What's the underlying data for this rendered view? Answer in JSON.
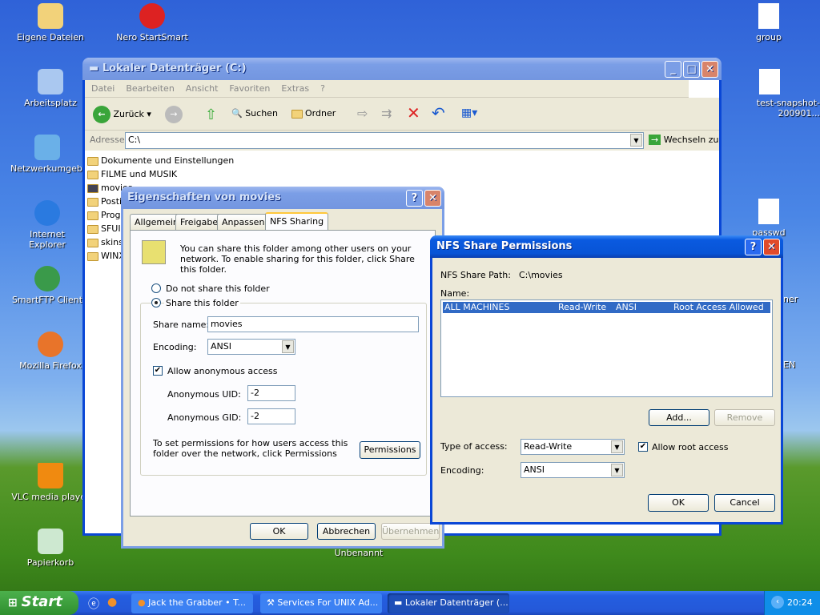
{
  "desktop": {
    "left_icons": [
      "Eigene Dateien",
      "Arbeitsplatz",
      "Netzwerkumgebung",
      "Internet Explorer",
      "SmartFTP Client",
      "Mozilla Firefox",
      "VLC media player",
      "Papierkorb"
    ],
    "nero": "Nero StartSmart",
    "right_icons": [
      "group",
      "test-snapshot-200901...",
      "passwd",
      "ner",
      "EN"
    ],
    "unbenannt": "Unbenannt"
  },
  "explorer": {
    "title": "Lokaler Datenträger (C:)",
    "menu": [
      "Datei",
      "Bearbeiten",
      "Ansicht",
      "Favoriten",
      "Extras",
      "?"
    ],
    "toolbar": {
      "back": "Zurück",
      "search": "Suchen",
      "folders": "Ordner"
    },
    "address_label": "Adresse",
    "address_value": "C:\\",
    "go": "Wechseln zu",
    "files": [
      "Dokumente und Einstellungen",
      "FILME und MUSIK",
      "movies",
      "Postit",
      "Programme",
      "SFUI",
      "skins",
      "WINXP"
    ]
  },
  "props": {
    "title": "Eigenschaften von movies",
    "tabs": [
      "Allgemein",
      "Freigabe",
      "Anpassen",
      "NFS Sharing"
    ],
    "active_tab": "NFS Sharing",
    "intro": "You can share this folder among other users on your network. To enable sharing for this folder, click Share this folder.",
    "no_share": "Do not share this folder",
    "share": "Share this folder",
    "share_name_label": "Share name:",
    "share_name": "movies",
    "encoding_label": "Encoding:",
    "encoding": "ANSI",
    "anon": "Allow anonymous access",
    "anon_checked": true,
    "uid_label": "Anonymous UID:",
    "uid": "-2",
    "gid_label": "Anonymous GID:",
    "gid": "-2",
    "perm_text": "To set permissions for how users access this folder over the network, click Permissions",
    "perm_btn": "Permissions",
    "ok": "OK",
    "cancel": "Abbrechen",
    "apply": "Übernehmen"
  },
  "nfs": {
    "title": "NFS Share Permissions",
    "path_label": "NFS Share Path:",
    "path": "C:\\movies",
    "name_label": "Name:",
    "rows": [
      {
        "name": "ALL MACHINES",
        "access": "Read-Write",
        "encoding": "ANSI",
        "root": "Root Access Allowed"
      }
    ],
    "add": "Add...",
    "remove": "Remove",
    "type_label": "Type of access:",
    "type": "Read-Write",
    "root_label": "Allow root access",
    "root_checked": true,
    "encoding_label": "Encoding:",
    "encoding": "ANSI",
    "ok": "OK",
    "cancel": "Cancel"
  },
  "taskbar": {
    "start": "Start",
    "tasks": [
      "Jack the Grabber • T...",
      "Services For UNIX Ad...",
      "Lokaler Datenträger (..."
    ],
    "active_task": 2,
    "clock": "20:24"
  }
}
